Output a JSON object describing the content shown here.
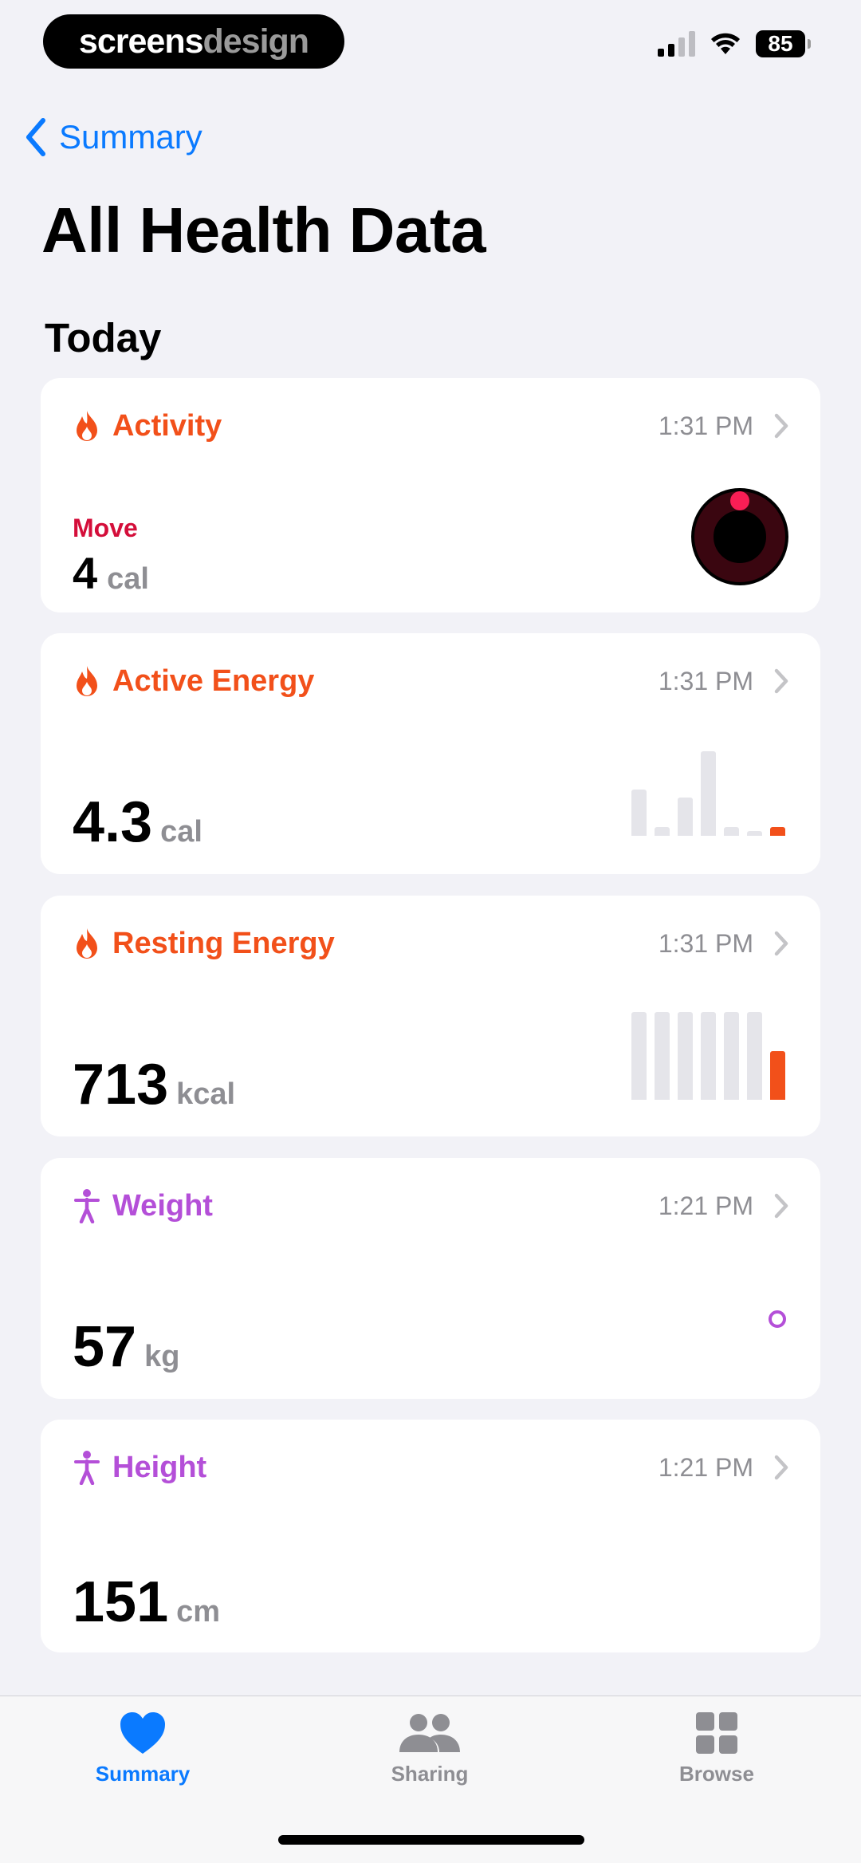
{
  "status_bar": {
    "brand_part1": "screens",
    "brand_part2": "design",
    "battery": "85"
  },
  "nav": {
    "back_label": "Summary"
  },
  "page": {
    "title": "All Health Data",
    "section": "Today"
  },
  "cards": {
    "activity": {
      "label": "Activity",
      "time": "1:31 PM",
      "icon": "flame-icon",
      "move_label": "Move",
      "value": "4",
      "unit": "cal",
      "ring_progress": 0.01
    },
    "active_energy": {
      "label": "Active Energy",
      "time": "1:31 PM",
      "icon": "flame-icon",
      "value": "4.3",
      "unit": "cal",
      "bar_levels": [
        0.55,
        0.1,
        0.45,
        1.0,
        0.1,
        0.06,
        0.1
      ]
    },
    "resting_energy": {
      "label": "Resting Energy",
      "time": "1:31 PM",
      "icon": "flame-icon",
      "value": "713",
      "unit": "kcal",
      "bar_levels": [
        1.0,
        1.0,
        1.0,
        1.0,
        1.0,
        1.0,
        0.55
      ]
    },
    "weight": {
      "label": "Weight",
      "time": "1:21 PM",
      "icon": "body-figure-icon",
      "value": "57",
      "unit": "kg"
    },
    "height": {
      "label": "Height",
      "time": "1:21 PM",
      "icon": "body-figure-icon",
      "value": "151",
      "unit": "cm"
    }
  },
  "tab_bar": {
    "summary": "Summary",
    "sharing": "Sharing",
    "browse": "Browse",
    "active": "Summary"
  },
  "colors": {
    "accent": "#0A7AFF",
    "activity": "#F2501A",
    "body": "#B44FD8",
    "move": "#D40E3A",
    "background": "#F2F2F7"
  }
}
